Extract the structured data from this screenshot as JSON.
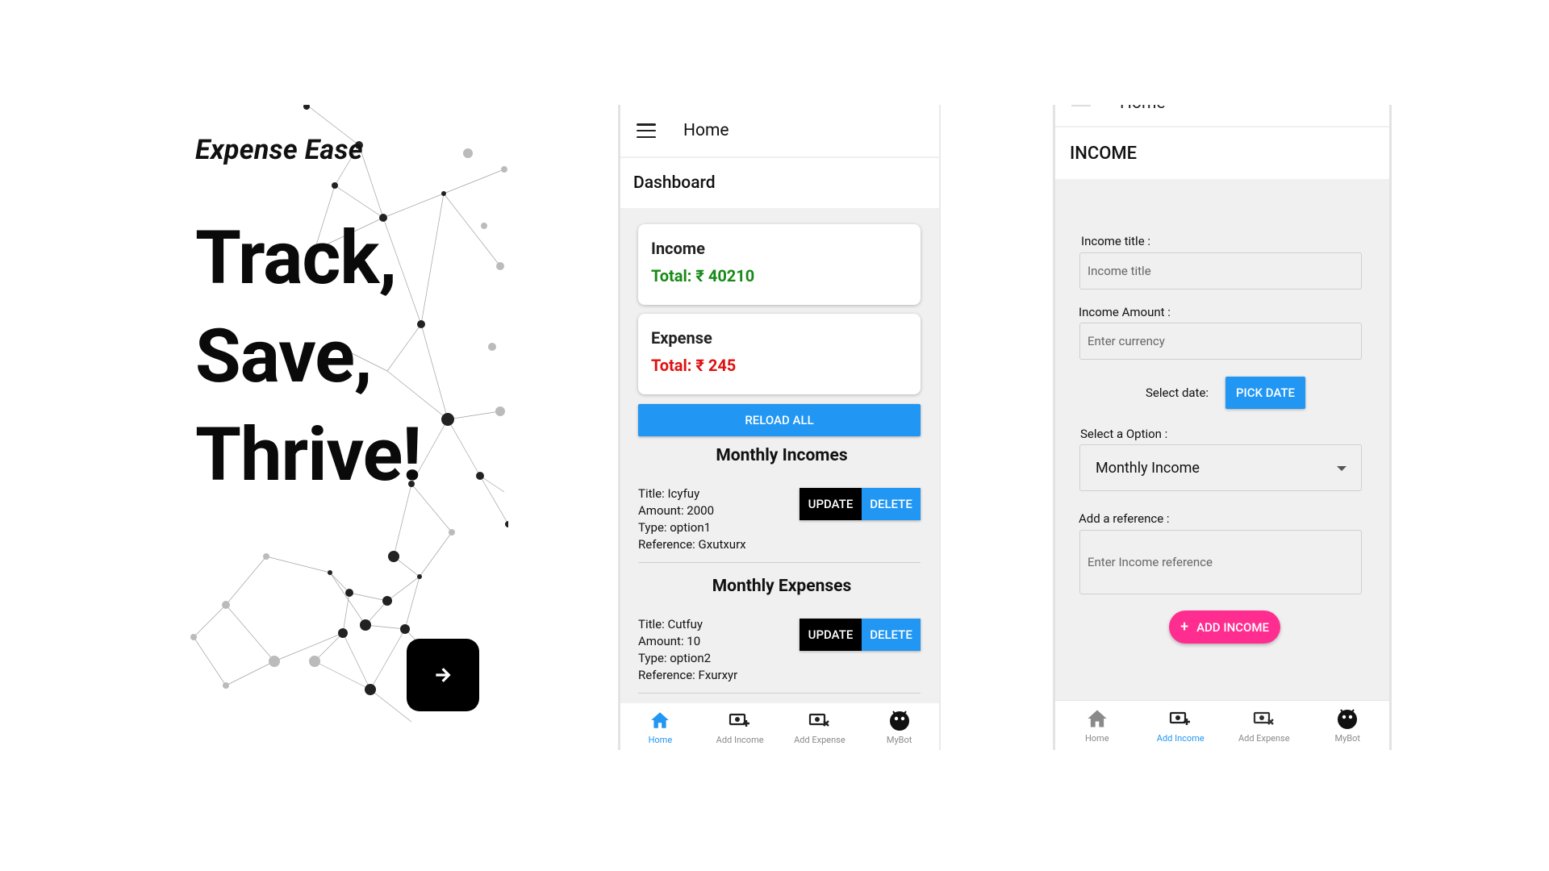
{
  "splash": {
    "brand": "Expense Ease",
    "tagline": [
      "Track,",
      "Save,",
      "Thrive!"
    ]
  },
  "home": {
    "title": "Home",
    "subtitle": "Dashboard",
    "income_card": {
      "label": "Income",
      "total": "Total:  ₹ 40210"
    },
    "expense_card": {
      "label": "Expense",
      "total": "Total:  ₹ 245"
    },
    "reload_label": "RELOAD ALL",
    "incomes_heading": "Monthly Incomes",
    "incomes": [
      {
        "title": "Title: Icyfuy",
        "amount": "Amount: 2000",
        "type": "Type: option1",
        "reference": "Reference: Gxutxurx"
      }
    ],
    "expenses_heading": "Monthly Expenses",
    "expenses": [
      {
        "title": "Title: Cutfuy",
        "amount": "Amount: 10",
        "type": "Type: option2",
        "reference": "Reference: Fxurxyr"
      }
    ],
    "update_label": "UPDATE",
    "delete_label": "DELETE",
    "tabs": [
      "Home",
      "Add Income",
      "Add Expense",
      "MyBot"
    ]
  },
  "income": {
    "ghost_title": "Home",
    "title": "INCOME",
    "title_label": "Income title :",
    "title_placeholder": "Income title",
    "amount_label": "Income Amount :",
    "amount_placeholder": "Enter currency",
    "date_label": "Select date:",
    "pick_date": "PICK DATE",
    "option_label": "Select a Option :",
    "option_value": "Monthly Income",
    "reference_label": "Add a reference :",
    "reference_placeholder": "Enter Income reference",
    "add_button": "ADD INCOME",
    "tabs": [
      "Home",
      "Add Income",
      "Add Expense",
      "MyBot"
    ]
  },
  "colors": {
    "accent_blue": "#2196f3",
    "income_green": "#178a17",
    "expense_red": "#e01010",
    "add_pink": "#ff2d8f"
  }
}
